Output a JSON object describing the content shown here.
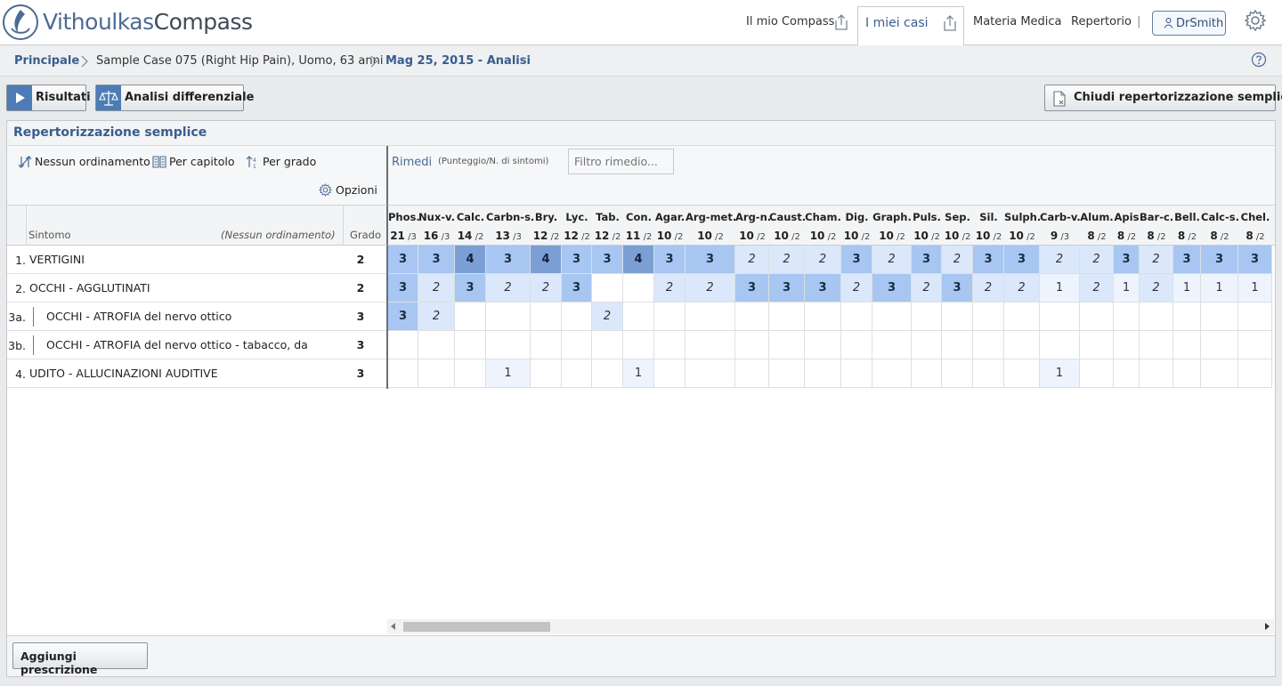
{
  "app": {
    "logo_part1": "Vithoulkas",
    "logo_part2": "Compass"
  },
  "nav": {
    "my_compass": "Il mio Compass",
    "my_cases": "I miei casi",
    "materia_medica": "Materia Medica",
    "repertory": "Repertorio",
    "separator": "|",
    "user": "DrSmith"
  },
  "breadcrumb": {
    "home": "Principale",
    "case": "Sample Case 075 (Right Hip Pain), Uomo, 63 anni",
    "analysis": "Mag 25, 2015 - Analisi"
  },
  "toolbar": {
    "results": "Risultati",
    "differential": "Analisi differenziale",
    "close_simple": "Chiudi repertorizzazione semplice"
  },
  "panel": {
    "title": "Repertorizzazione semplice",
    "sort_none": "Nessun ordinamento",
    "sort_chapter": "Per capitolo",
    "sort_grade": "Per grado",
    "options": "Opzioni",
    "remedies_label": "Rimedi",
    "remedies_hint": "(Punteggio/N. di sintomi)",
    "remedy_filter_placeholder": "Filtro rimedio...",
    "col_symptom": "Sintomo",
    "col_symptom_sort": "(Nessun ordinamento)",
    "col_grade": "Grado",
    "add_prescription": "Aggiungi prescrizione"
  },
  "symptoms": [
    {
      "num": "1.",
      "text": "VERTIGINI",
      "grade": "2"
    },
    {
      "num": "2.",
      "text": "OCCHI - AGGLUTINATI",
      "grade": "2"
    },
    {
      "num": "3a.",
      "text": "OCCHI - ATROFIA del nervo ottico",
      "grade": "3"
    },
    {
      "num": "3b.",
      "text": "OCCHI - ATROFIA del nervo ottico - tabacco, da",
      "grade": "3"
    },
    {
      "num": "4.",
      "text": "UDITO - ALLUCINAZIONI AUDITIVE",
      "grade": "3"
    }
  ],
  "remedies": [
    {
      "name": "Phos.",
      "score": "21",
      "count": "/3",
      "cells": [
        "3",
        "3",
        "3",
        "",
        ""
      ]
    },
    {
      "name": "Nux-v.",
      "score": "16",
      "count": "/3",
      "cells": [
        "3",
        "2",
        "2",
        "",
        ""
      ]
    },
    {
      "name": "Calc.",
      "score": "14",
      "count": "/2",
      "cells": [
        "4",
        "3",
        "",
        "",
        ""
      ]
    },
    {
      "name": "Carbn-s.",
      "score": "13",
      "count": "/3",
      "cells": [
        "3",
        "2",
        "",
        "",
        "1"
      ]
    },
    {
      "name": "Bry.",
      "score": "12",
      "count": "/2",
      "cells": [
        "4",
        "2",
        "",
        "",
        ""
      ]
    },
    {
      "name": "Lyc.",
      "score": "12",
      "count": "/2",
      "cells": [
        "3",
        "3",
        "",
        "",
        ""
      ]
    },
    {
      "name": "Tab.",
      "score": "12",
      "count": "/2",
      "cells": [
        "3",
        "",
        "2",
        "",
        ""
      ]
    },
    {
      "name": "Con.",
      "score": "11",
      "count": "/2",
      "cells": [
        "4",
        "",
        "",
        "",
        "1"
      ]
    },
    {
      "name": "Agar.",
      "score": "10",
      "count": "/2",
      "cells": [
        "3",
        "2",
        "",
        "",
        ""
      ]
    },
    {
      "name": "Arg-met.",
      "score": "10",
      "count": "/2",
      "cells": [
        "3",
        "2",
        "",
        "",
        ""
      ]
    },
    {
      "name": "Arg-n.",
      "score": "10",
      "count": "/2",
      "cells": [
        "2",
        "3",
        "",
        "",
        ""
      ]
    },
    {
      "name": "Caust.",
      "score": "10",
      "count": "/2",
      "cells": [
        "2",
        "3",
        "",
        "",
        ""
      ]
    },
    {
      "name": "Cham.",
      "score": "10",
      "count": "/2",
      "cells": [
        "2",
        "3",
        "",
        "",
        ""
      ]
    },
    {
      "name": "Dig.",
      "score": "10",
      "count": "/2",
      "cells": [
        "3",
        "2",
        "",
        "",
        ""
      ]
    },
    {
      "name": "Graph.",
      "score": "10",
      "count": "/2",
      "cells": [
        "2",
        "3",
        "",
        "",
        ""
      ]
    },
    {
      "name": "Puls.",
      "score": "10",
      "count": "/2",
      "cells": [
        "3",
        "2",
        "",
        "",
        ""
      ]
    },
    {
      "name": "Sep.",
      "score": "10",
      "count": "/2",
      "cells": [
        "2",
        "3",
        "",
        "",
        ""
      ]
    },
    {
      "name": "Sil.",
      "score": "10",
      "count": "/2",
      "cells": [
        "3",
        "2",
        "",
        "",
        ""
      ]
    },
    {
      "name": "Sulph.",
      "score": "10",
      "count": "/2",
      "cells": [
        "3",
        "2",
        "",
        "",
        ""
      ]
    },
    {
      "name": "Carb-v.",
      "score": "9",
      "count": "/3",
      "cells": [
        "2",
        "1",
        "",
        "",
        "1"
      ]
    },
    {
      "name": "Alum.",
      "score": "8",
      "count": "/2",
      "cells": [
        "2",
        "2",
        "",
        "",
        ""
      ]
    },
    {
      "name": "Apis",
      "score": "8",
      "count": "/2",
      "cells": [
        "3",
        "1",
        "",
        "",
        ""
      ]
    },
    {
      "name": "Bar-c.",
      "score": "8",
      "count": "/2",
      "cells": [
        "2",
        "2",
        "",
        "",
        ""
      ]
    },
    {
      "name": "Bell.",
      "score": "8",
      "count": "/2",
      "cells": [
        "3",
        "1",
        "",
        "",
        ""
      ]
    },
    {
      "name": "Calc-s.",
      "score": "8",
      "count": "/2",
      "cells": [
        "3",
        "1",
        "",
        "",
        ""
      ]
    },
    {
      "name": "Chel.",
      "score": "8",
      "count": "/2",
      "cells": [
        "3",
        "1",
        "",
        "",
        ""
      ]
    }
  ],
  "colors": {
    "accent": "#3a5d8c",
    "grade4": "#7b9fd4",
    "grade3": "#a7c6f1",
    "grade2": "#dbe8fb",
    "grade1": "#eef4fd"
  }
}
